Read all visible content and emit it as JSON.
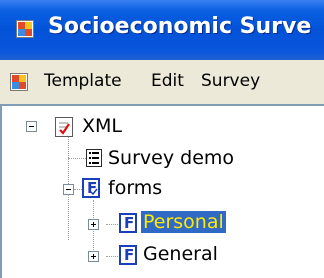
{
  "window": {
    "title": "Socioeconomic Surve",
    "icon": "app-icon"
  },
  "menubar": {
    "icon": "app-icon",
    "items": [
      {
        "label": "Template"
      },
      {
        "label": "Edit"
      },
      {
        "label": "Survey"
      }
    ]
  },
  "tree": {
    "nodes": [
      {
        "label": "XML",
        "icon": "xml-document-icon",
        "expanded": true
      },
      {
        "label": "Survey demo",
        "icon": "survey-list-icon"
      },
      {
        "label": "forms",
        "icon": "forms-folder-icon",
        "expanded": true
      },
      {
        "label": "Personal",
        "icon": "form-icon",
        "selected": true,
        "expanded": false
      },
      {
        "label": "General",
        "icon": "form-icon",
        "expanded": false
      }
    ]
  },
  "colors": {
    "titlebar": "#0252d8",
    "selection_bg": "#316ac5",
    "selection_fg": "#ffea00",
    "form_icon": "#1b3fb8"
  }
}
